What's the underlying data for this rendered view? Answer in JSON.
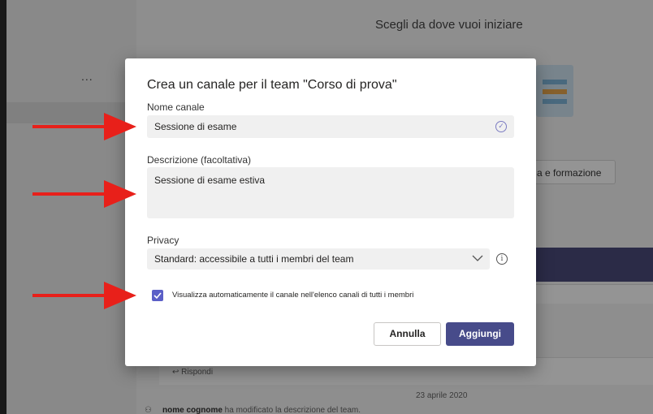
{
  "background": {
    "rail_more": "...",
    "header_title": "Scegli da dove vuoi iniziare",
    "training_button": "a e formazione",
    "reply_label": "↩ Rispondi",
    "date_label": "23 aprile 2020",
    "activity_author": "nome cognome",
    "activity_text": " ha modificato la descrizione del team."
  },
  "dialog": {
    "title": "Crea un canale per il team \"Corso di prova\"",
    "name_label": "Nome canale",
    "name_value": "Sessione di esame",
    "description_label": "Descrizione (facoltativa)",
    "description_value": "Sessione di esame estiva",
    "privacy_label": "Privacy",
    "privacy_value": "Standard: accessibile a tutti i membri del team",
    "auto_show_label": "Visualizza automaticamente il canale nell'elenco canali di tutti i membri",
    "auto_show_checked": true,
    "cancel_label": "Annulla",
    "add_label": "Aggiungi"
  },
  "colors": {
    "accent": "#474b8a",
    "checkbox": "#5b5fc7",
    "annotation_arrow": "#e8201a"
  },
  "icons": {
    "name_valid": "check-circle-icon",
    "privacy_dropdown": "chevron-down-icon",
    "privacy_info": "info-icon",
    "checkbox": "checkmark-icon",
    "annotation": "red-arrow-icon"
  }
}
